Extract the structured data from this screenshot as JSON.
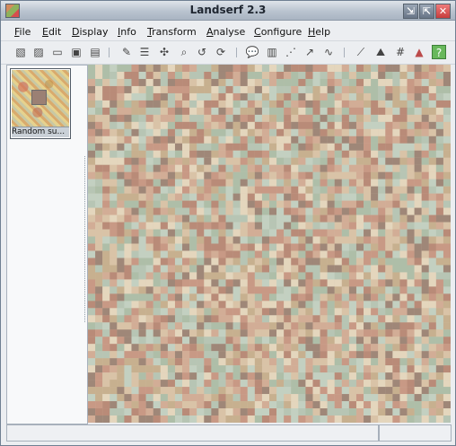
{
  "window": {
    "title": "Landserf 2.3",
    "buttons": [
      "minimize",
      "maximize",
      "close"
    ]
  },
  "menus": [
    {
      "label": "File",
      "mnemonic": "F"
    },
    {
      "label": "Edit",
      "mnemonic": "E"
    },
    {
      "label": "Display",
      "mnemonic": "D"
    },
    {
      "label": "Info",
      "mnemonic": "I"
    },
    {
      "label": "Transform",
      "mnemonic": "T"
    },
    {
      "label": "Analyse",
      "mnemonic": "A"
    },
    {
      "label": "Configure",
      "mnemonic": "C"
    },
    {
      "label": "Help",
      "mnemonic": "H"
    }
  ],
  "toolbar": [
    {
      "icon": "new-surface-icon"
    },
    {
      "icon": "new-map-icon"
    },
    {
      "icon": "open-folder-icon"
    },
    {
      "icon": "save-icon"
    },
    {
      "icon": "print-icon"
    },
    {
      "icon": "edit-pencil-icon"
    },
    {
      "icon": "metadata-icon"
    },
    {
      "icon": "transform-icon"
    },
    {
      "icon": "zoom-icon"
    },
    {
      "icon": "rotate-icon"
    },
    {
      "icon": "refresh-icon"
    },
    {
      "icon": "info-bubble-icon"
    },
    {
      "icon": "histogram-icon"
    },
    {
      "icon": "scatter-icon"
    },
    {
      "icon": "query-cursor-icon"
    },
    {
      "icon": "profile-icon"
    },
    {
      "icon": "slope-icon"
    },
    {
      "icon": "feature-icon"
    },
    {
      "icon": "grid-icon"
    },
    {
      "icon": "peak-icon"
    },
    {
      "icon": "help-icon"
    }
  ],
  "thumbnails": [
    {
      "label": "Random su..."
    }
  ],
  "map": {
    "rows": 50,
    "cols": 50,
    "palette": [
      "#d9c3a7",
      "#c89985",
      "#b7c5b4",
      "#e4d6bd",
      "#b98b78",
      "#d2ad96",
      "#aebea8",
      "#c7b08f",
      "#9f8778",
      "#c3d0c1"
    ]
  },
  "status": {
    "left": "",
    "right": ""
  }
}
